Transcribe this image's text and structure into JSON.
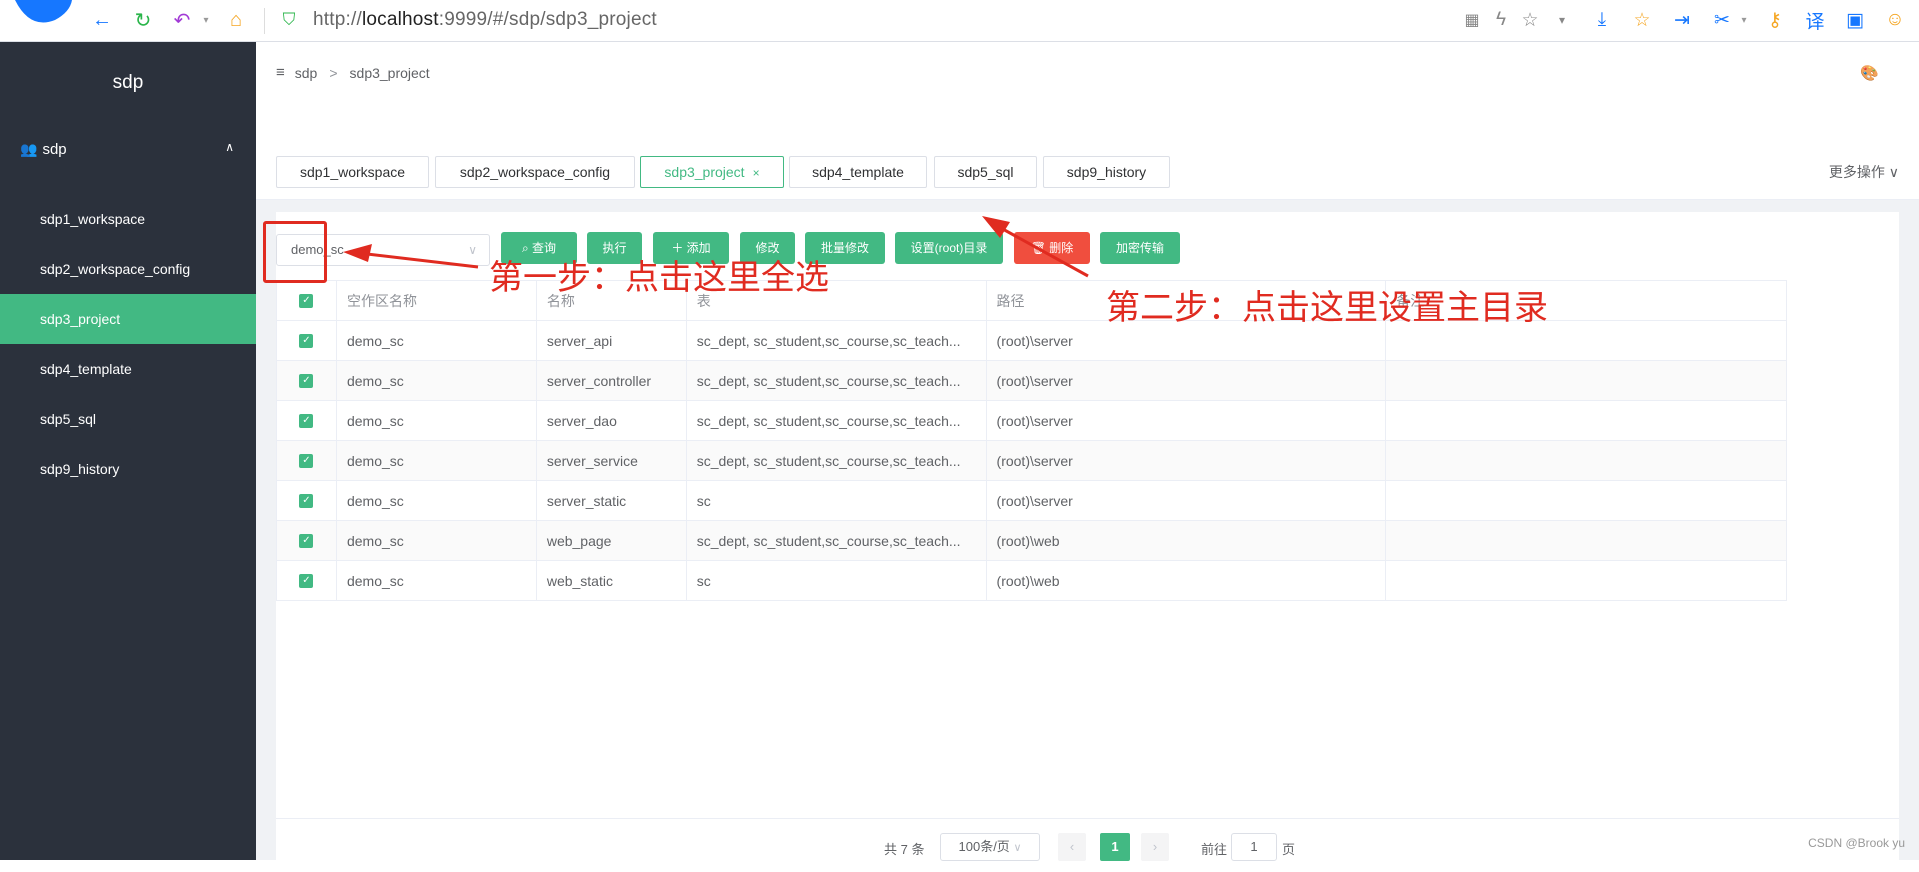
{
  "browser": {
    "url_prefix": "http://",
    "url_host": "localhost",
    "url_rest": ":9999/#/sdp/sdp3_project"
  },
  "sidebar": {
    "title": "sdp",
    "group_label": "sdp",
    "items": [
      {
        "label": "sdp1_workspace"
      },
      {
        "label": "sdp2_workspace_config"
      },
      {
        "label": "sdp3_project"
      },
      {
        "label": "sdp4_template"
      },
      {
        "label": "sdp5_sql"
      },
      {
        "label": "sdp9_history"
      }
    ]
  },
  "breadcrumb": {
    "root": "sdp",
    "current": "sdp3_project"
  },
  "tabs": [
    {
      "label": "sdp1_workspace"
    },
    {
      "label": "sdp2_workspace_config"
    },
    {
      "label": "sdp3_project"
    },
    {
      "label": "sdp4_template"
    },
    {
      "label": "sdp5_sql"
    },
    {
      "label": "sdp9_history"
    }
  ],
  "more_ops": "更多操作",
  "toolbar": {
    "select_value": "demo_sc",
    "query": "查询",
    "execute": "执行",
    "add": "添加",
    "edit": "修改",
    "batch_edit": "批量修改",
    "set_root": "设置(root)目录",
    "delete": "删除",
    "encrypt": "加密传输"
  },
  "table": {
    "headers": {
      "workspace": "空作区名称",
      "name": "名称",
      "table": "表",
      "path": "路径",
      "remark": "备注"
    },
    "rows": [
      {
        "workspace": "demo_sc",
        "name": "server_api",
        "table": "sc_dept, sc_student,sc_course,sc_teach...",
        "path": "(root)\\server",
        "remark": ""
      },
      {
        "workspace": "demo_sc",
        "name": "server_controller",
        "table": "sc_dept, sc_student,sc_course,sc_teach...",
        "path": "(root)\\server",
        "remark": ""
      },
      {
        "workspace": "demo_sc",
        "name": "server_dao",
        "table": "sc_dept, sc_student,sc_course,sc_teach...",
        "path": "(root)\\server",
        "remark": ""
      },
      {
        "workspace": "demo_sc",
        "name": "server_service",
        "table": "sc_dept, sc_student,sc_course,sc_teach...",
        "path": "(root)\\server",
        "remark": ""
      },
      {
        "workspace": "demo_sc",
        "name": "server_static",
        "table": "sc",
        "path": "(root)\\server",
        "remark": ""
      },
      {
        "workspace": "demo_sc",
        "name": "web_page",
        "table": "sc_dept, sc_student,sc_course,sc_teach...",
        "path": "(root)\\web",
        "remark": ""
      },
      {
        "workspace": "demo_sc",
        "name": "web_static",
        "table": "sc",
        "path": "(root)\\web",
        "remark": ""
      }
    ]
  },
  "pagination": {
    "total": "共 7 条",
    "page_size": "100条/页",
    "current_page": "1",
    "goto_label": "前往",
    "goto_value": "1",
    "page_unit": "页"
  },
  "annotations": {
    "step1": "第一步：点击这里全选",
    "step2": "第二步：点击这里设置主目录",
    "color": "#e02b20"
  },
  "watermark": "CSDN @Brook yu",
  "colors": {
    "accent": "#42b983",
    "danger": "#f04e3e",
    "sidebar": "#2b313c"
  }
}
